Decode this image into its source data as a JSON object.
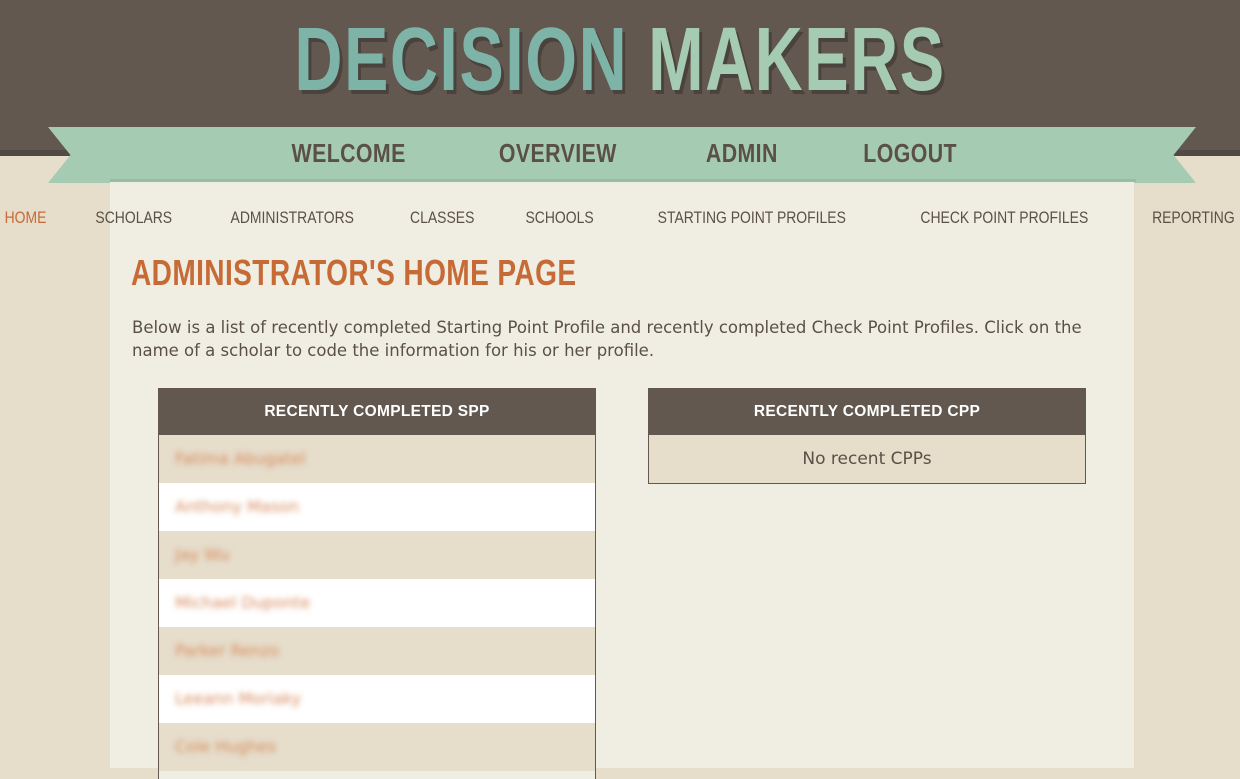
{
  "header": {
    "brand_word1": "DECISION",
    "brand_word2": "MAKERS",
    "colors": {
      "band": "#625850",
      "teal": "#7eb3a7",
      "mint": "#a6cbb3",
      "accent": "#c66a36"
    }
  },
  "main_nav": [
    {
      "label": "WELCOME"
    },
    {
      "label": "OVERVIEW"
    },
    {
      "label": "ADMIN"
    },
    {
      "label": "LOGOUT"
    }
  ],
  "sub_nav": [
    {
      "label": "HOME",
      "active": true
    },
    {
      "label": "SCHOLARS"
    },
    {
      "label": "ADMINISTRATORS"
    },
    {
      "label": "CLASSES"
    },
    {
      "label": "SCHOOLS"
    },
    {
      "label": "STARTING POINT PROFILES"
    },
    {
      "label": "CHECK POINT PROFILES"
    },
    {
      "label": "REPORTING"
    }
  ],
  "page": {
    "title": "ADMINISTRATOR'S HOME PAGE",
    "intro": "Below is a list of recently completed Starting Point Profile and recently completed Check Point Profiles. Click on the name of a scholar to code the information for his or her profile."
  },
  "spp": {
    "heading": "RECENTLY COMPLETED SPP",
    "rows": [
      "Fatima Abugatel",
      "Anthony Mason",
      "Jay Wu",
      "Michael Duponte",
      "Parker Renzo",
      "Leeann Moriaky",
      "Cole Hughes"
    ]
  },
  "cpp": {
    "heading": "RECENTLY COMPLETED CPP",
    "empty": "No recent CPPs"
  }
}
